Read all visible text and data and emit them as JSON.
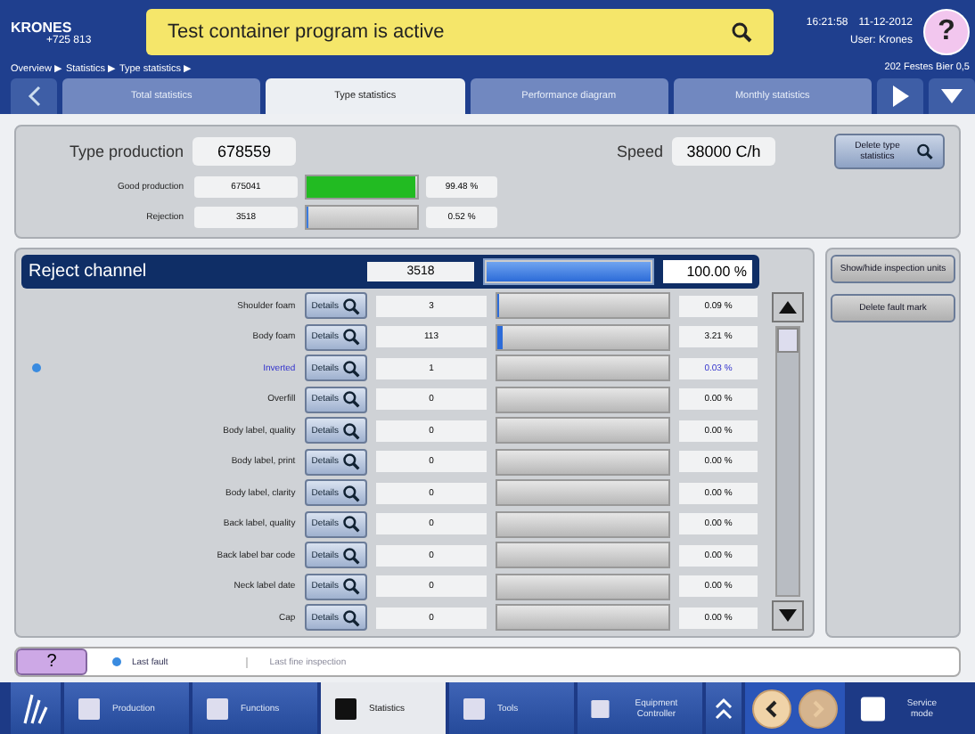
{
  "header": {
    "brand": "KRONES",
    "machine": "+725 813",
    "help": "?",
    "message": "Test container program is active",
    "time": "16:21:58",
    "date": "11-12-2012",
    "user": "User: Krones",
    "product": "202 Festes Bier 0,5",
    "breadcrumb": "Overview ▶ Statistics ▶ Type statistics ▶"
  },
  "tabs": [
    {
      "label": "Total statistics",
      "selected": false
    },
    {
      "label": "Type statistics",
      "selected": true
    },
    {
      "label": "Performance diagram",
      "selected": false
    },
    {
      "label": "Monthly statistics",
      "selected": false
    }
  ],
  "summary": {
    "type_label": "Type production",
    "type_value": "678559",
    "speed_label": "Speed",
    "speed_value": "38000 C/h",
    "delete_button": "Delete type statistics",
    "rows": [
      {
        "label": "Good production",
        "value": "675041",
        "level": 0.99,
        "percent": "99.48 %",
        "color": "#22bb22"
      },
      {
        "label": "Rejection",
        "value": "3518",
        "level": 0.005,
        "percent": "0.52 %",
        "color": "#3a7be0"
      }
    ]
  },
  "reject": {
    "title": "Reject channel",
    "total": "3518",
    "level": 1,
    "percent": "100.00 %",
    "rows": [
      {
        "label": "Shoulder foam",
        "details": "Details",
        "value": "3",
        "level": 0.001,
        "percent": "0.09 %",
        "selected": false
      },
      {
        "label": "Body foam",
        "details": "Details",
        "value": "113",
        "level": 0.03,
        "percent": "3.21 %",
        "selected": false
      },
      {
        "label": "Inverted",
        "details": "Details",
        "value": "1",
        "percent": "0.03 %",
        "selected": true
      },
      {
        "label": "Overfill",
        "details": "Details",
        "value": "0",
        "percent": "0.00 %",
        "selected": false
      },
      {
        "label": "Body label, quality",
        "details": "Details",
        "value": "0",
        "percent": "0.00 %",
        "selected": false
      },
      {
        "label": "Body label, print",
        "details": "Details",
        "value": "0",
        "percent": "0.00 %",
        "selected": false
      },
      {
        "label": "Body label, clarity",
        "details": "Details",
        "value": "0",
        "percent": "0.00 %",
        "selected": false
      },
      {
        "label": "Back label, quality",
        "details": "Details",
        "value": "0",
        "percent": "0.00 %",
        "selected": false
      },
      {
        "label": "Back label bar code",
        "details": "Details",
        "value": "0",
        "percent": "0.00 %",
        "selected": false
      },
      {
        "label": "Neck label date",
        "details": "Details",
        "value": "0",
        "percent": "0.00 %",
        "selected": false
      },
      {
        "label": "Cap",
        "details": "Details",
        "value": "0",
        "percent": "0.00 %",
        "selected": false
      }
    ]
  },
  "side_buttons": [
    "Show/hide inspection units",
    "Delete fault mark"
  ],
  "legend": {
    "help": "?",
    "last_fault": "Last fault",
    "last_inspection": "Last fine inspection"
  },
  "taskbar": [
    {
      "label": "Production",
      "selected": false
    },
    {
      "label": "Functions",
      "selected": false
    },
    {
      "label": "Statistics",
      "selected": true
    },
    {
      "label": "Tools",
      "selected": false
    },
    {
      "label": "Equipment Controller",
      "selected": false
    }
  ],
  "service": "Service mode"
}
